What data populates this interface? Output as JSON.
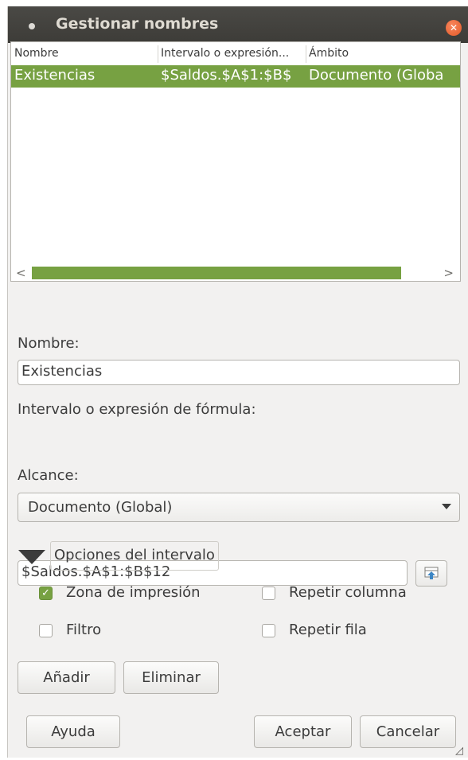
{
  "window": {
    "title": "Gestionar nombres"
  },
  "list": {
    "columns": [
      "Nombre",
      "Intervalo o expresión...",
      "Ámbito"
    ],
    "rows": [
      {
        "name": "Existencias",
        "range": "$Saldos.$A$1:$B$",
        "scope": "Documento (Globa"
      }
    ],
    "scroll_left": "<",
    "scroll_right": ">"
  },
  "form": {
    "name_label": "Nombre:",
    "name_value": "Existencias",
    "range_label": "Intervalo o expresión de fórmula:",
    "range_value": "$Saldos.$A$1:$B$12",
    "scope_label": "Alcance:",
    "scope_value": "Documento (Global)"
  },
  "options": {
    "expander_label": "Opciones del intervalo",
    "print_area": {
      "label": "Zona de impresión",
      "checked": true
    },
    "repeat_column": {
      "label": "Repetir columna",
      "checked": false
    },
    "filter": {
      "label": "Filtro",
      "checked": false
    },
    "repeat_row": {
      "label": "Repetir fila",
      "checked": false
    }
  },
  "buttons": {
    "add": "Añadir",
    "delete": "Eliminar",
    "help": "Ayuda",
    "ok": "Aceptar",
    "cancel": "Cancelar"
  },
  "colors": {
    "accent": "#77a142",
    "titlebar": "#3d3c38",
    "close": "#e35a28"
  }
}
